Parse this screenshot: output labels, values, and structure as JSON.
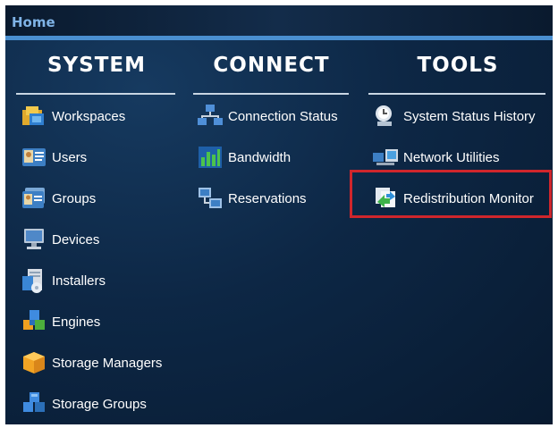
{
  "header": {
    "title": "Home"
  },
  "columns": {
    "system": {
      "heading": "SYSTEM",
      "items": [
        {
          "label": "Workspaces",
          "icon": "workspaces-icon"
        },
        {
          "label": "Users",
          "icon": "users-icon"
        },
        {
          "label": "Groups",
          "icon": "groups-icon"
        },
        {
          "label": "Devices",
          "icon": "devices-icon"
        },
        {
          "label": "Installers",
          "icon": "installers-icon"
        },
        {
          "label": "Engines",
          "icon": "engines-icon"
        },
        {
          "label": "Storage Managers",
          "icon": "storage-managers-icon"
        },
        {
          "label": "Storage Groups",
          "icon": "storage-groups-icon"
        }
      ]
    },
    "connect": {
      "heading": "CONNECT",
      "items": [
        {
          "label": "Connection Status",
          "icon": "connection-status-icon"
        },
        {
          "label": "Bandwidth",
          "icon": "bandwidth-icon"
        },
        {
          "label": "Reservations",
          "icon": "reservations-icon"
        }
      ]
    },
    "tools": {
      "heading": "TOOLS",
      "items": [
        {
          "label": "System Status History",
          "icon": "system-status-history-icon"
        },
        {
          "label": "Network Utilities",
          "icon": "network-utilities-icon"
        },
        {
          "label": "Redistribution Monitor",
          "icon": "redistribution-monitor-icon"
        }
      ]
    }
  },
  "highlighted_item": "Redistribution Monitor",
  "colors": {
    "background": "#0d2745",
    "title": "#7fb3e6",
    "accent_rule": "#4a8fd0",
    "highlight": "#d0262c"
  }
}
